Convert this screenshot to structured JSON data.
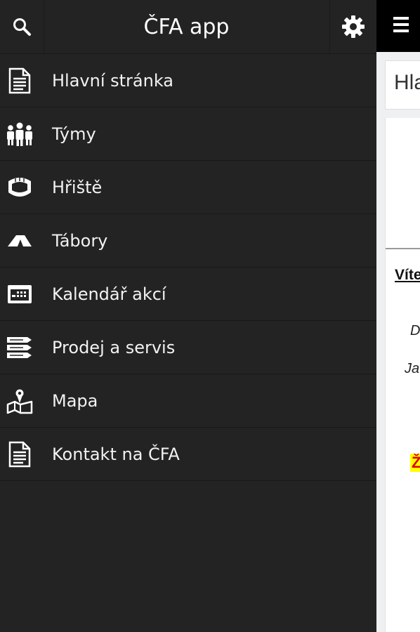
{
  "drawer": {
    "title": "ČFA app",
    "menu": [
      {
        "label": "Hlavní stránka",
        "icon": "document-icon"
      },
      {
        "label": "Týmy",
        "icon": "team-icon"
      },
      {
        "label": "Hřiště",
        "icon": "stadium-icon"
      },
      {
        "label": "Tábory",
        "icon": "tent-icon"
      },
      {
        "label": "Kalendář akcí",
        "icon": "calendar-icon"
      },
      {
        "label": "Prodej a servis",
        "icon": "shop-icon"
      },
      {
        "label": "Mapa",
        "icon": "map-icon"
      },
      {
        "label": "Kontakt na ČFA",
        "icon": "document-icon"
      }
    ]
  },
  "main": {
    "title_partial": "Hla",
    "welcome_partial": "Víte",
    "line1_partial": "D",
    "line2_partial": "Ja",
    "highlight_partial": "Ž"
  },
  "colors": {
    "drawer_bg": "#232323",
    "topbar_bg": "#000000",
    "highlight_bg": "#ffff00",
    "highlight_text": "#e00000"
  }
}
